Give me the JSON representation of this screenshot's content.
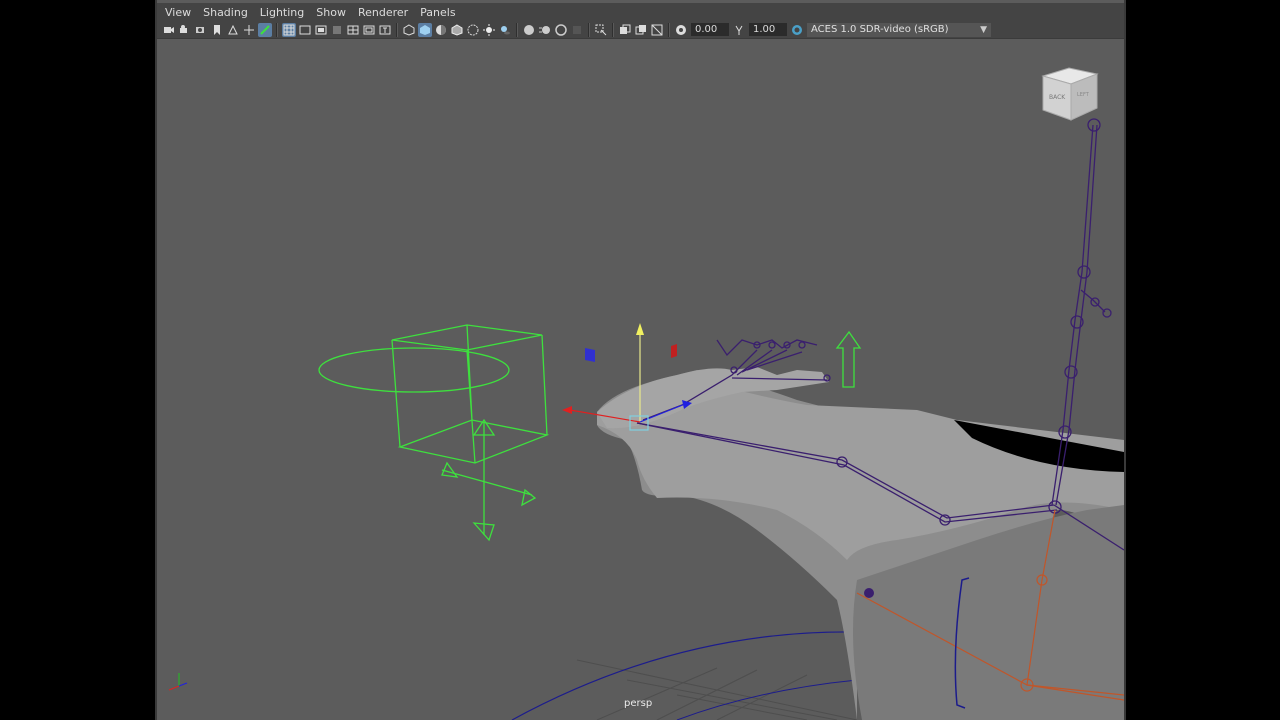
{
  "menu": [
    "View",
    "Shading",
    "Lighting",
    "Show",
    "Renderer",
    "Panels"
  ],
  "toolbar": {
    "exposure_value": "0.00",
    "gamma_value": "1.00",
    "color_space": "ACES 1.0 SDR-video (sRGB)"
  },
  "viewport": {
    "camera_label": "persp",
    "viewcube_faces": {
      "back": "BACK",
      "left": "LEFT"
    }
  },
  "colors": {
    "viewport_bg": "#5c5c5c",
    "control_green": "#3ee03e",
    "joint_purple": "#3a1f6e",
    "joint_orange": "#c0562a"
  }
}
